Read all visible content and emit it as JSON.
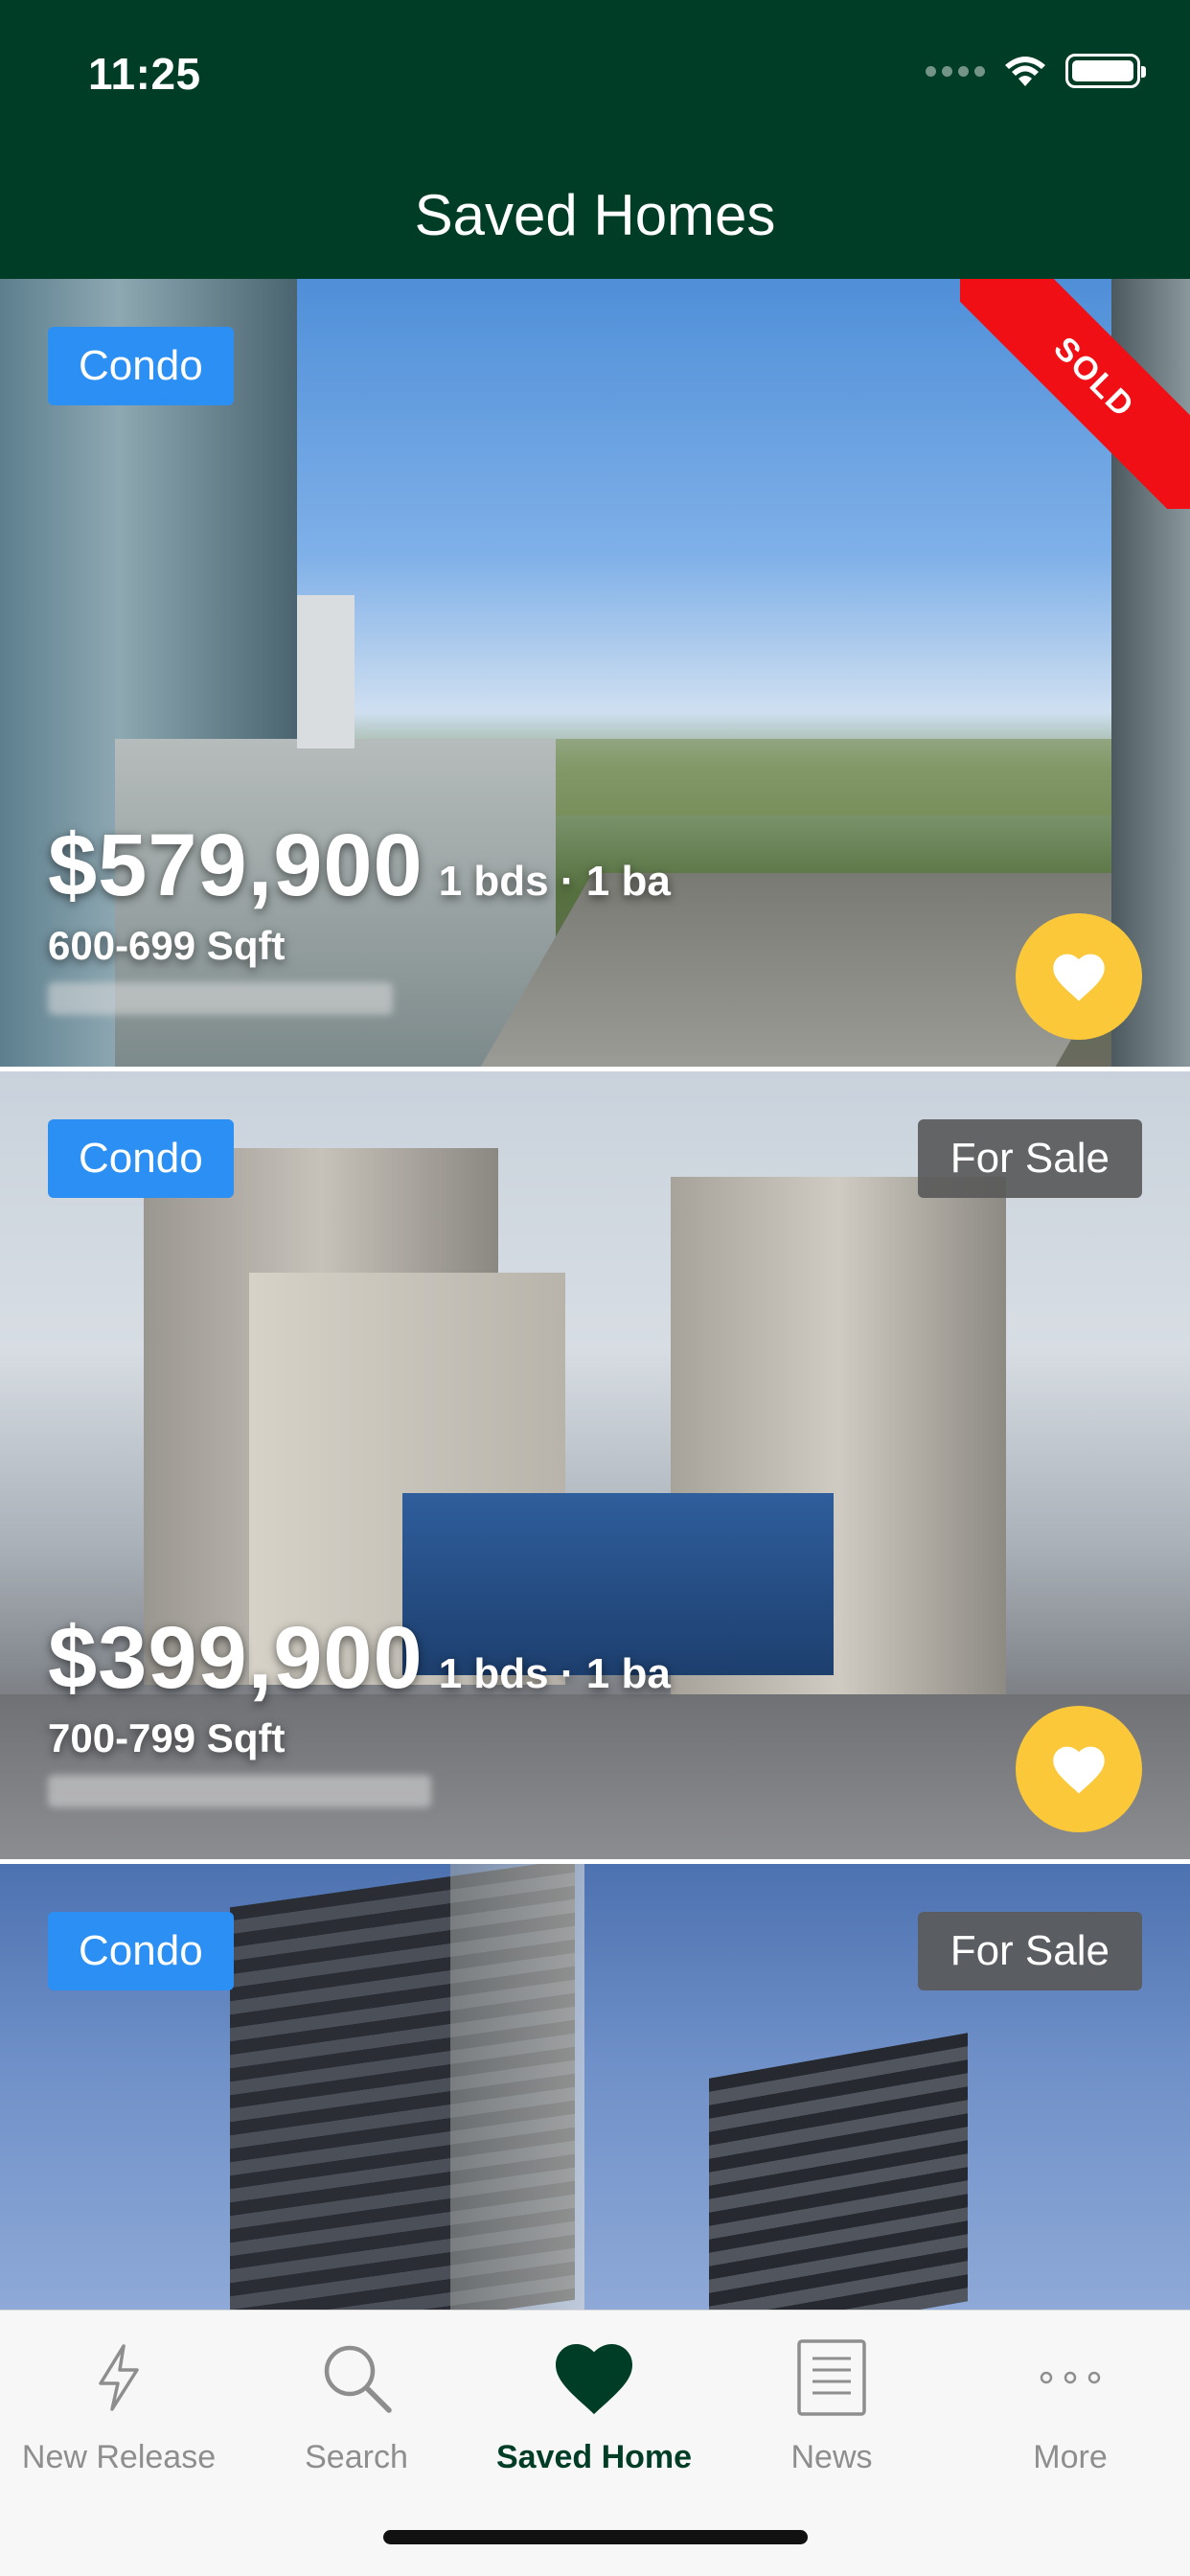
{
  "status_bar": {
    "time": "11:25"
  },
  "header": {
    "title": "Saved Homes"
  },
  "listings": [
    {
      "type_badge": "Condo",
      "status_ribbon": "SOLD",
      "price": "$579,900",
      "beds_baths": "1 bds · 1 ba",
      "sqft": "600-699 Sqft",
      "favorited": true
    },
    {
      "type_badge": "Condo",
      "status_badge": "For Sale",
      "price": "$399,900",
      "beds_baths": "1 bds · 1 ba",
      "sqft": "700-799 Sqft",
      "favorited": true
    },
    {
      "type_badge": "Condo",
      "status_badge": "For Sale"
    }
  ],
  "tabbar": {
    "items": [
      {
        "label": "New Release",
        "icon": "lightning-icon"
      },
      {
        "label": "Search",
        "icon": "search-icon"
      },
      {
        "label": "Saved Home",
        "icon": "heart-icon",
        "active": true
      },
      {
        "label": "News",
        "icon": "news-icon"
      },
      {
        "label": "More",
        "icon": "more-icon"
      }
    ]
  },
  "colors": {
    "header_bg": "#003d26",
    "type_badge_bg": "#2b8ff3",
    "sold_ribbon": "#ef0f15",
    "favorite_button": "#fbc83a",
    "tab_active": "#003d26"
  }
}
